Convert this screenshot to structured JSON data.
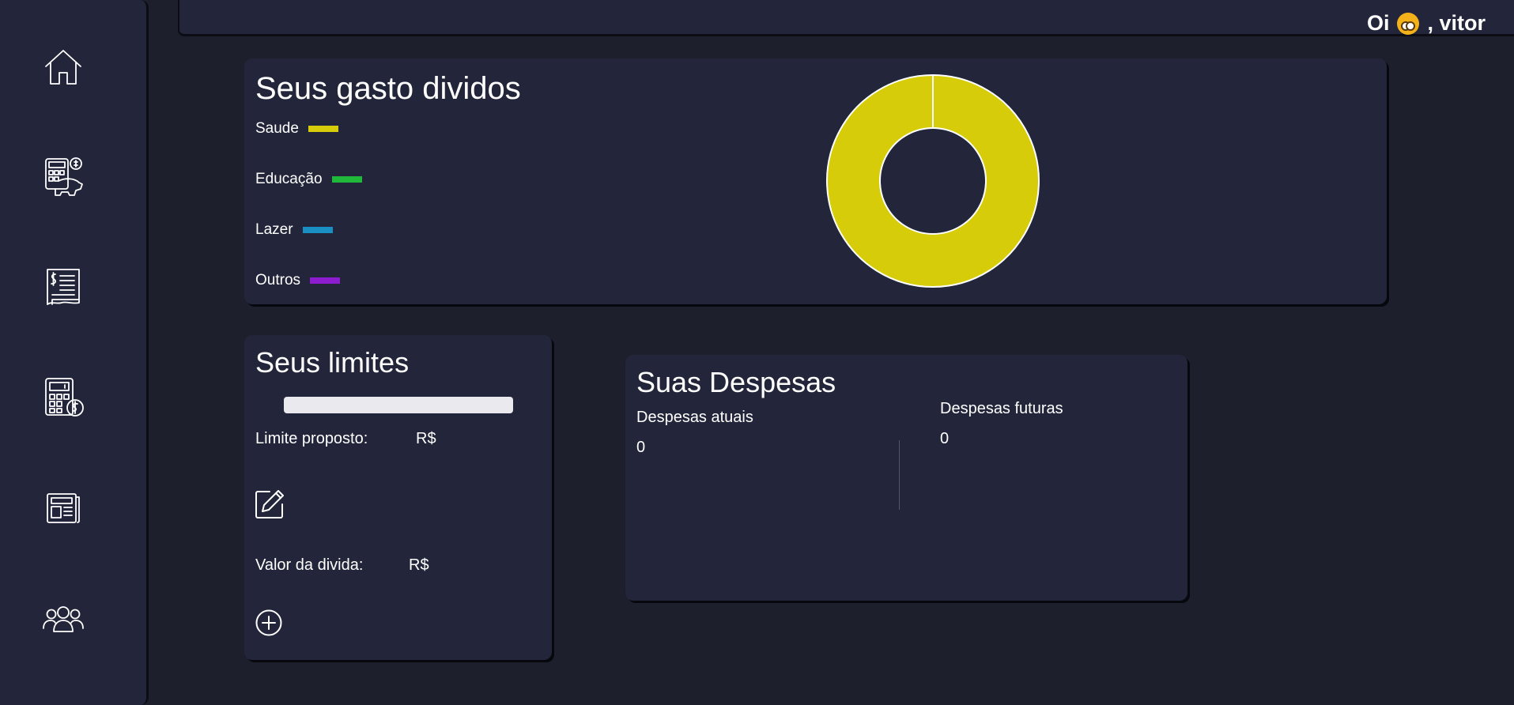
{
  "header": {
    "greeting_prefix": "Oi",
    "greeting_user": ", vitor",
    "emoji_icon": "face-emoji-icon"
  },
  "sidebar": {
    "items": [
      {
        "name": "home",
        "icon": "home-icon"
      },
      {
        "name": "calculator-finance",
        "icon": "calculator-piggy-icon"
      },
      {
        "name": "invoice",
        "icon": "receipt-icon"
      },
      {
        "name": "calculator",
        "icon": "calculator-dollar-icon"
      },
      {
        "name": "news",
        "icon": "newspaper-icon"
      },
      {
        "name": "users",
        "icon": "users-icon"
      }
    ]
  },
  "expenses_chart": {
    "title": "Seus gasto dividos",
    "legend": [
      {
        "label": "Saude",
        "color": "#d6cc0a"
      },
      {
        "label": "Educação",
        "color": "#1fb83a"
      },
      {
        "label": "Lazer",
        "color": "#1a8fc3"
      },
      {
        "label": "Outros",
        "color": "#8d1ccf"
      }
    ]
  },
  "chart_data": {
    "type": "pie",
    "categories": [
      "Saude",
      "Educação",
      "Lazer",
      "Outros"
    ],
    "values": [
      100,
      0,
      0,
      0
    ],
    "colors": [
      "#d6cc0a",
      "#1fb83a",
      "#1a8fc3",
      "#8d1ccf"
    ],
    "donut": true
  },
  "limits": {
    "title": "Seus limites",
    "progress": 0,
    "limit_label": "Limite proposto:",
    "limit_currency": "R$",
    "debt_label": "Valor da divida:",
    "debt_currency": "R$"
  },
  "despesas": {
    "title": "Suas Despesas",
    "current_label": "Despesas atuais",
    "current_value": "0",
    "future_label": "Despesas futuras",
    "future_value": "0"
  }
}
